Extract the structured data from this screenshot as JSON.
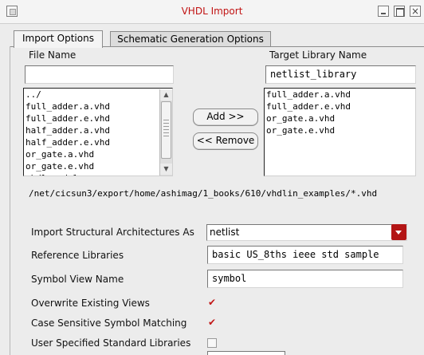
{
  "window": {
    "title": "VHDL  Import",
    "close_glyph": "×"
  },
  "tabs": [
    {
      "label": "Import Options",
      "active": true
    },
    {
      "label": "Schematic Generation Options",
      "active": false
    }
  ],
  "file_panel": {
    "label": "File Name",
    "input_value": "",
    "files": [
      "../",
      "full_adder.a.vhd",
      "full_adder.e.vhd",
      "half_adder.a.vhd",
      "half_adder.e.vhd",
      "or_gate.a.vhd",
      "or_gate.e.vhd",
      "vhdl_model"
    ]
  },
  "target_panel": {
    "label": "Target Library Name",
    "input_value": "netlist_library",
    "files": [
      "full_adder.a.vhd",
      "full_adder.e.vhd",
      "or_gate.a.vhd",
      "or_gate.e.vhd"
    ]
  },
  "buttons": {
    "add": "Add >>",
    "remove": "<< Remove"
  },
  "path": "/net/cicsun3/export/home/ashimag/1_books/610/vhdlin_examples/*.vhd",
  "options": {
    "import_structural_label": "Import Structural Architectures As",
    "import_structural_value": "netlist",
    "reference_libraries_label": "Reference Libraries",
    "reference_libraries_value": "basic US_8ths ieee std sample",
    "symbol_view_label": "Symbol View Name",
    "symbol_view_value": "symbol",
    "overwrite_label": "Overwrite Existing Views",
    "overwrite_checked": true,
    "case_sensitive_label": "Case Sensitive Symbol Matching",
    "case_sensitive_checked": true,
    "user_std_label": "User Specified Standard Libraries",
    "user_std_checked": false
  },
  "check_glyph": "✔",
  "colors": {
    "title": "#c11313",
    "accent": "#b31515"
  }
}
